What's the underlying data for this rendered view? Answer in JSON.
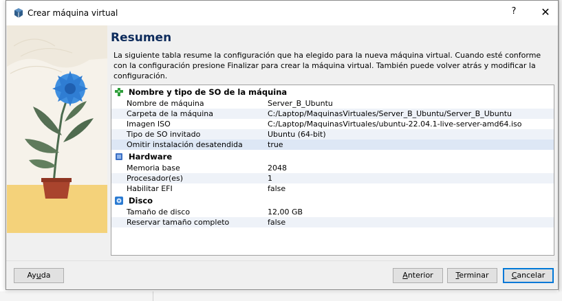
{
  "window": {
    "title": "Crear máquina virtual",
    "help_label": "?",
    "close_label": "✕"
  },
  "page": {
    "heading": "Resumen",
    "description": "La siguiente tabla resume la configuración que ha elegido para la nueva máquina virtual. Cuando esté conforme con la configuración presione Finalizar para crear la máquina virtual. También puede volver atrás y modificar la configuración."
  },
  "summary": {
    "sections": [
      {
        "title": "Nombre y tipo de SO de la máquina",
        "icon": "puzzle-icon",
        "rows": [
          {
            "key": "Nombre de máquina",
            "value": "Server_B_Ubuntu"
          },
          {
            "key": "Carpeta de la máquina",
            "value": "C:/Laptop/MaquinasVirtuales/Server_B_Ubuntu/Server_B_Ubuntu"
          },
          {
            "key": "Imagen ISO",
            "value": "C:/Laptop/MaquinasVirtuales/ubuntu-22.04.1-live-server-amd64.iso"
          },
          {
            "key": "Tipo de SO invitado",
            "value": "Ubuntu (64-bit)"
          },
          {
            "key": "Omitir instalación desatendida",
            "value": "true"
          }
        ]
      },
      {
        "title": "Hardware",
        "icon": "chip-icon",
        "rows": [
          {
            "key": "Memoria base",
            "value": "2048"
          },
          {
            "key": "Procesador(es)",
            "value": "1"
          },
          {
            "key": "Habilitar EFI",
            "value": "false"
          }
        ]
      },
      {
        "title": "Disco",
        "icon": "disk-icon",
        "rows": [
          {
            "key": "Tamaño de disco",
            "value": "12,00 GB"
          },
          {
            "key": "Reservar tamaño completo",
            "value": "false"
          }
        ]
      }
    ]
  },
  "buttons": {
    "help": {
      "pre": "Ay",
      "ul": "u",
      "post": "da"
    },
    "back": {
      "pre": "",
      "ul": "A",
      "post": "nterior"
    },
    "finish": {
      "pre": "",
      "ul": "T",
      "post": "erminar"
    },
    "cancel": {
      "pre": "",
      "ul": "C",
      "post": "ancelar"
    }
  },
  "colors": {
    "heading": "#0d2b5c",
    "accent": "#0078d7",
    "selected_row": "#dde7f5"
  }
}
